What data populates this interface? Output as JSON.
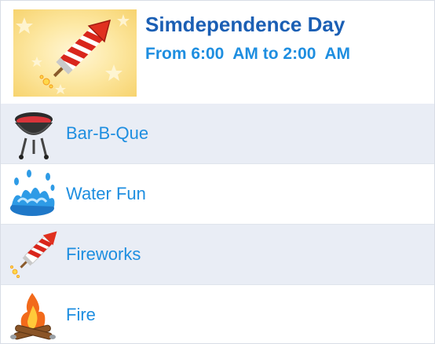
{
  "event": {
    "title": "Simdependence Day",
    "time": "From 6:00  AM to 2:00  AM"
  },
  "activities": [
    {
      "label": "Bar-B-Que",
      "icon": "grill-icon"
    },
    {
      "label": "Water Fun",
      "icon": "water-splash-icon"
    },
    {
      "label": "Fireworks",
      "icon": "firework-rocket-icon"
    },
    {
      "label": "Fire",
      "icon": "campfire-icon"
    }
  ],
  "colors": {
    "title": "#1b5fb4",
    "accent": "#1e8ee0",
    "row_alt": "#e9edf5"
  }
}
